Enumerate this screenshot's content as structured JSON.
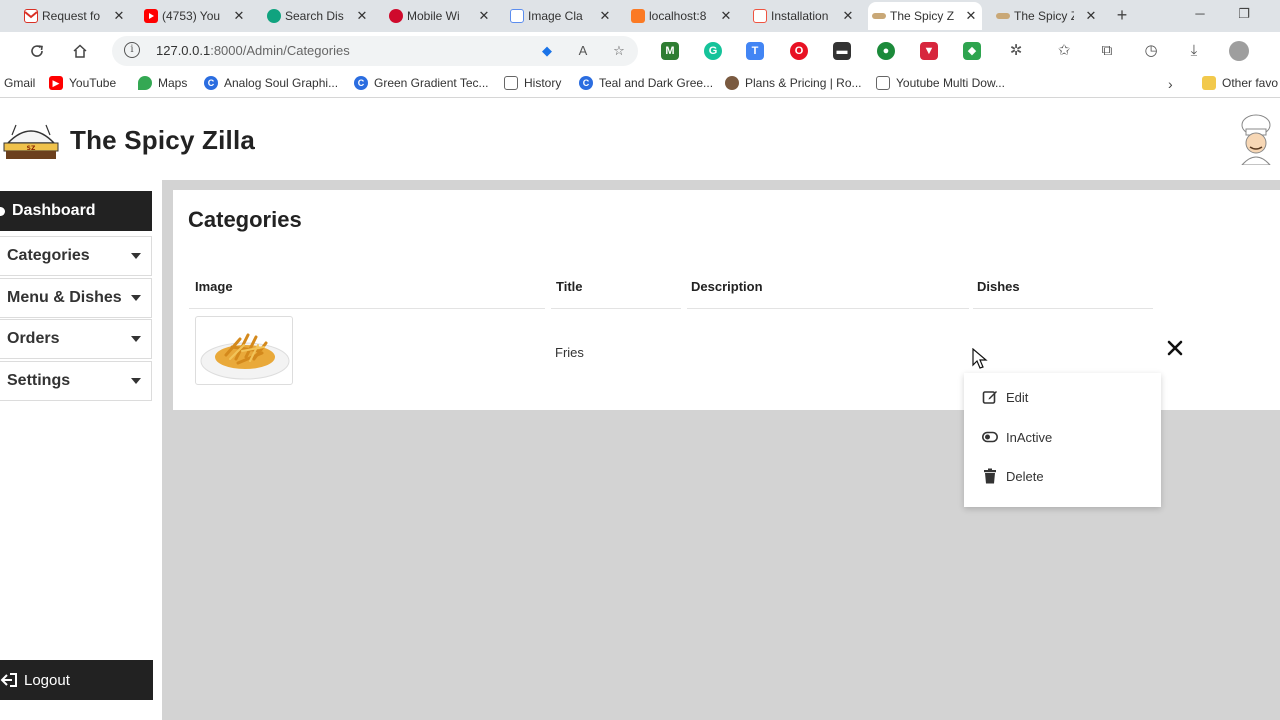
{
  "browser": {
    "tabs": [
      {
        "label": "Request fo",
        "icon": "gmail-icon",
        "color": "#d93025"
      },
      {
        "label": "(4753) You",
        "icon": "youtube-icon",
        "color": "#ff0000"
      },
      {
        "label": "Search Dis",
        "icon": "chatgpt-icon",
        "color": "#10a37f"
      },
      {
        "label": "Mobile Wi",
        "icon": "huawei-icon",
        "color": "#cf0a2c"
      },
      {
        "label": "Image Cla",
        "icon": "flag-icon",
        "color": "#5b8def"
      },
      {
        "label": "localhost:8",
        "icon": "xampp-icon",
        "color": "#fb7a24"
      },
      {
        "label": "Installation",
        "icon": "laravel-icon",
        "color": "#f05340"
      },
      {
        "label": "The Spicy Z",
        "icon": "spicyzilla-icon",
        "color": "#8a6d3b"
      },
      {
        "label": "The Spicy Z",
        "icon": "spicyzilla-icon",
        "color": "#8a6d3b"
      }
    ],
    "url_host": "127.0.0.1",
    "url_path": ":8000/Admin/Categories",
    "bookmarks": [
      {
        "label": "Gmail",
        "icon": "gmail-icon",
        "color": "#d93025"
      },
      {
        "label": "YouTube",
        "icon": "youtube-icon",
        "color": "#ff0000"
      },
      {
        "label": "Maps",
        "icon": "maps-icon",
        "color": "#34a853"
      },
      {
        "label": "Analog Soul Graphi...",
        "icon": "c-icon",
        "color": "#2b6de0"
      },
      {
        "label": "Green Gradient Tec...",
        "icon": "c-icon",
        "color": "#2b6de0"
      },
      {
        "label": "History",
        "icon": "page-icon",
        "color": "#666666"
      },
      {
        "label": "Teal and Dark Gree...",
        "icon": "c-icon",
        "color": "#2b6de0"
      },
      {
        "label": "Plans & Pricing | Ro...",
        "icon": "avatar-icon",
        "color": "#7a5a40"
      },
      {
        "label": "Youtube Multi Dow...",
        "icon": "page-icon",
        "color": "#666666"
      }
    ],
    "other_favorites": "Other favo"
  },
  "app": {
    "title": "The Spicy Zilla"
  },
  "sidebar": {
    "items": [
      {
        "label": "Dashboard"
      },
      {
        "label": "Categories"
      },
      {
        "label": "Menu & Dishes"
      },
      {
        "label": "Orders"
      },
      {
        "label": "Settings"
      }
    ],
    "logout": "Logout"
  },
  "main": {
    "page_title": "Categories",
    "columns": [
      "Image",
      "Title",
      "Description",
      "Dishes"
    ],
    "rows": [
      {
        "title": "Fries",
        "description": "",
        "dishes": ""
      }
    ]
  },
  "menu": {
    "items": [
      {
        "label": "Edit",
        "icon": "edit-icon"
      },
      {
        "label": "InActive",
        "icon": "toggle-icon"
      },
      {
        "label": "Delete",
        "icon": "trash-icon"
      }
    ]
  },
  "colors": {
    "sidebar_active": "#222222",
    "main_background": "#d3d3d3",
    "card_background": "#ffffff"
  }
}
